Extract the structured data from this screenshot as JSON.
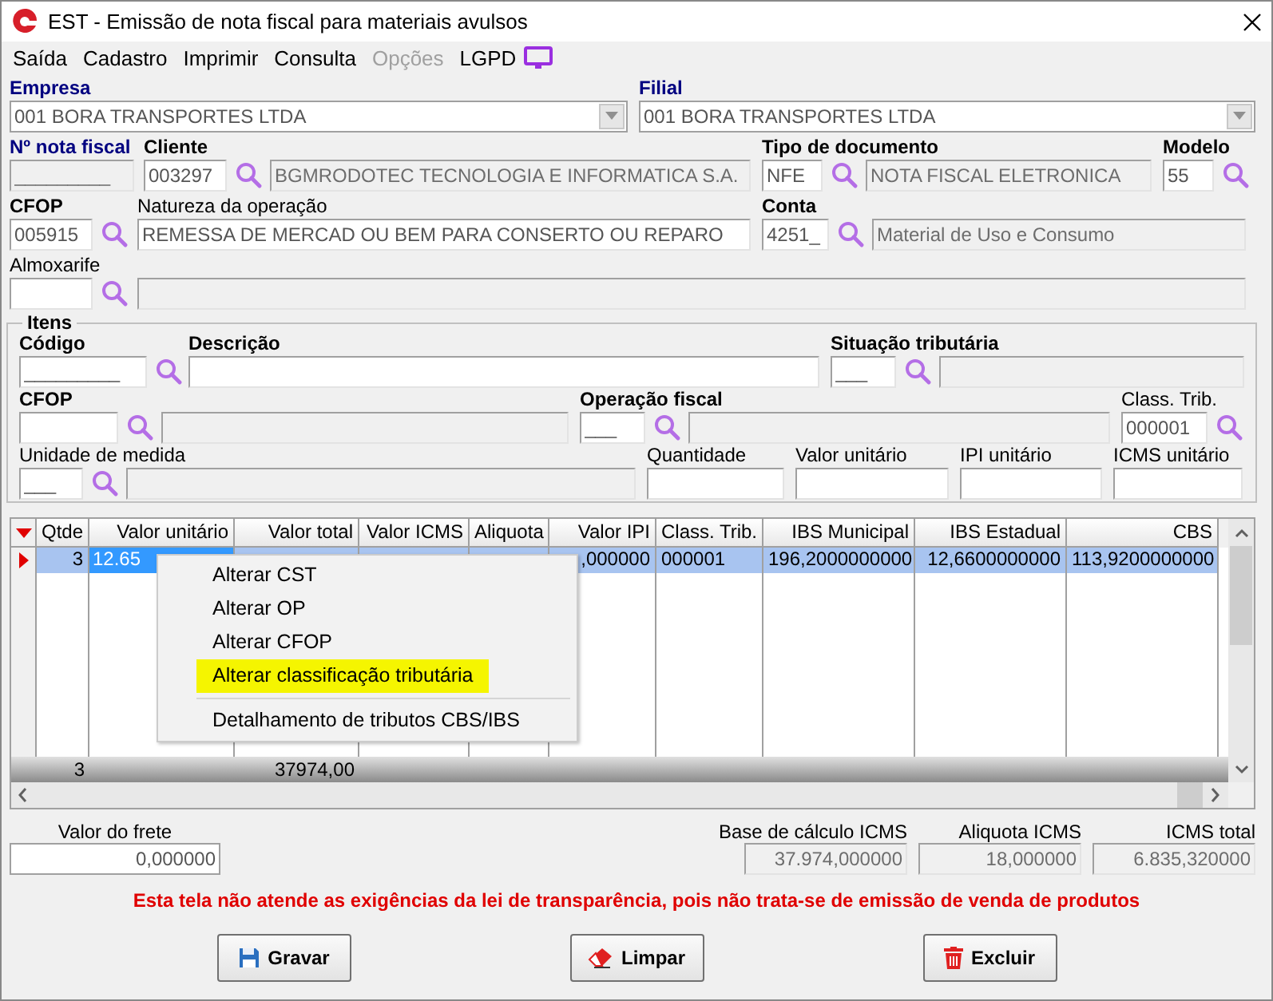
{
  "window": {
    "title": "EST - Emissão de nota fiscal para materiais avulsos"
  },
  "menu": [
    {
      "label": "Saída",
      "disabled": false
    },
    {
      "label": "Cadastro",
      "disabled": false
    },
    {
      "label": "Imprimir",
      "disabled": false
    },
    {
      "label": "Consulta",
      "disabled": false
    },
    {
      "label": "Opções",
      "disabled": true
    },
    {
      "label": "LGPD",
      "disabled": false
    }
  ],
  "form_rows": [
    {
      "groups": [
        {
          "label": {
            "text": "Empresa",
            "kind": "required"
          },
          "fields": [
            {
              "kind": "combo",
              "value": "001 BORA TRANSPORTES LTDA",
              "disabled": false
            }
          ]
        },
        {
          "label": {
            "text": "Filial",
            "kind": "required"
          },
          "fields": [
            {
              "kind": "combo",
              "value": "001 BORA TRANSPORTES LTDA",
              "disabled": false
            }
          ]
        }
      ]
    },
    {
      "groups": [
        {
          "label": {
            "text": "Nº nota fiscal",
            "kind": "required"
          },
          "fields": [
            {
              "kind": "input",
              "value": "_________",
              "disabled": true
            }
          ]
        },
        {
          "label": {
            "text": "Cliente",
            "kind": "bold"
          },
          "fields": [
            {
              "kind": "lookup",
              "value": "003297",
              "disabled": false
            },
            {
              "kind": "input",
              "value": "BGMRODOTEC TECNOLOGIA E INFORMATICA S.A.",
              "disabled": true
            }
          ]
        },
        {
          "label": {
            "text": "Tipo de documento",
            "kind": "bold"
          },
          "fields": [
            {
              "kind": "lookup",
              "value": "NFE",
              "disabled": false
            },
            {
              "kind": "input",
              "value": "NOTA FISCAL ELETRONICA",
              "disabled": true
            }
          ]
        },
        {
          "label": {
            "text": "Modelo",
            "kind": "bold"
          },
          "fields": [
            {
              "kind": "lookup",
              "value": "55",
              "disabled": false
            }
          ]
        }
      ]
    },
    {
      "groups": [
        {
          "label": {
            "text": "CFOP",
            "kind": "bold"
          },
          "fields": [
            {
              "kind": "lookup",
              "value": "005915",
              "disabled": false
            }
          ]
        },
        {
          "label": {
            "text": "Natureza da operação",
            "kind": "plain"
          },
          "fields": [
            {
              "kind": "input",
              "value": "REMESSA DE MERCAD OU BEM PARA CONSERTO OU REPARO",
              "disabled": false
            }
          ]
        },
        {
          "label": {
            "text": "Conta",
            "kind": "bold"
          },
          "fields": [
            {
              "kind": "lookup",
              "value": "4251_",
              "disabled": false
            },
            {
              "kind": "input",
              "value": "Material de Uso e Consumo",
              "disabled": true
            }
          ]
        }
      ]
    },
    {
      "groups": [
        {
          "label": {
            "text": "Almoxarife",
            "kind": "plain"
          },
          "fields": [
            {
              "kind": "lookup",
              "disabled": false
            }
          ]
        },
        {
          "fields": [
            {
              "kind": "input",
              "disabled": true
            }
          ]
        }
      ]
    }
  ],
  "items": {
    "title": "Itens",
    "rows": [
      {
        "groups": [
          {
            "label": {
              "text": "Código",
              "kind": "bold"
            },
            "fields": [
              {
                "kind": "lookup",
                "value": "_________",
                "disabled": false
              }
            ]
          },
          {
            "label": {
              "text": "Descrição",
              "kind": "bold"
            },
            "fields": [
              {
                "kind": "input",
                "disabled": false
              }
            ]
          },
          {
            "label": {
              "text": "Situação tributária",
              "kind": "bold"
            },
            "fields": [
              {
                "kind": "lookup",
                "value": "___",
                "disabled": false
              },
              {
                "kind": "input",
                "disabled": true
              }
            ]
          }
        ]
      },
      {
        "groups": [
          {
            "label": {
              "text": "CFOP",
              "kind": "bold"
            },
            "fields": [
              {
                "kind": "lookup",
                "disabled": false
              },
              {
                "kind": "input",
                "disabled": true
              }
            ]
          },
          {
            "label": {
              "text": "Operação fiscal",
              "kind": "bold"
            },
            "fields": [
              {
                "kind": "lookup",
                "value": "___",
                "disabled": false
              },
              {
                "kind": "input",
                "disabled": true
              }
            ]
          },
          {
            "label": {
              "text": "Class. Trib.",
              "kind": "plain"
            },
            "fields": [
              {
                "kind": "lookup",
                "value": "000001",
                "disabled": false
              }
            ]
          }
        ]
      },
      {
        "groups": [
          {
            "label": {
              "text": "Unidade de medida",
              "kind": "plain"
            },
            "fields": [
              {
                "kind": "lookup",
                "value": "___",
                "disabled": false
              },
              {
                "kind": "input",
                "disabled": true
              }
            ]
          },
          {
            "label": {
              "text": "Quantidade",
              "kind": "plain"
            },
            "fields": [
              {
                "kind": "input",
                "disabled": false
              }
            ]
          },
          {
            "label": {
              "text": "Valor unitário",
              "kind": "plain"
            },
            "fields": [
              {
                "kind": "input",
                "disabled": false
              }
            ]
          },
          {
            "label": {
              "text": "IPI unitário",
              "kind": "plain"
            },
            "fields": [
              {
                "kind": "input",
                "disabled": false
              }
            ]
          },
          {
            "label": {
              "text": "ICMS unitário",
              "kind": "plain"
            },
            "fields": [
              {
                "kind": "input",
                "disabled": false
              }
            ]
          }
        ]
      }
    ]
  },
  "table": {
    "columns": [
      "Qtde",
      "Valor unitário",
      "Valor total",
      "Valor ICMS",
      "Aliquota",
      "Valor IPI",
      "Class. Trib.",
      "IBS Municipal",
      "IBS Estadual",
      "CBS"
    ],
    "rows": [
      {
        "selected": true,
        "cells": [
          {
            "text": "3",
            "focused": false
          },
          {
            "text": "12.65",
            "focused": true
          },
          null,
          null,
          null,
          {
            "text": ",000000",
            "focused": false
          },
          {
            "text": "000001",
            "focused": false
          },
          {
            "text": "196,2000000000",
            "focused": false
          },
          {
            "text": "12,6600000000",
            "focused": false
          },
          {
            "text": "113,9200000000",
            "focused": false
          }
        ]
      }
    ],
    "totals": {
      "qtde": "3",
      "valor_total": "37974,00"
    }
  },
  "context_menu": [
    {
      "kind": "item",
      "label": "Alterar CST",
      "selected": false
    },
    {
      "kind": "item",
      "label": "Alterar OP",
      "selected": false
    },
    {
      "kind": "item",
      "label": "Alterar CFOP",
      "selected": false
    },
    {
      "kind": "item",
      "label": "Alterar classificação tributária",
      "selected": true
    },
    {
      "kind": "separator"
    },
    {
      "kind": "item",
      "label": "Detalhamento de tributos CBS/IBS",
      "selected": false
    }
  ],
  "summary": [
    {
      "label": "Valor do frete",
      "value": "0,000000",
      "disabled": false
    },
    {
      "label": "Base de cálculo ICMS",
      "value": "37.974,000000",
      "disabled": true
    },
    {
      "label": "Aliquota ICMS",
      "value": "18,000000",
      "disabled": true
    },
    {
      "label": "ICMS total",
      "value": "6.835,320000",
      "disabled": true
    }
  ],
  "notice": "Esta tela não atende as exigências da lei de transparência, pois não trata-se de emissão de venda de produtos",
  "buttons": [
    {
      "label": "Gravar",
      "kind": "save"
    },
    {
      "label": "Limpar",
      "kind": "clear"
    },
    {
      "label": "Excluir",
      "kind": "delete"
    }
  ]
}
